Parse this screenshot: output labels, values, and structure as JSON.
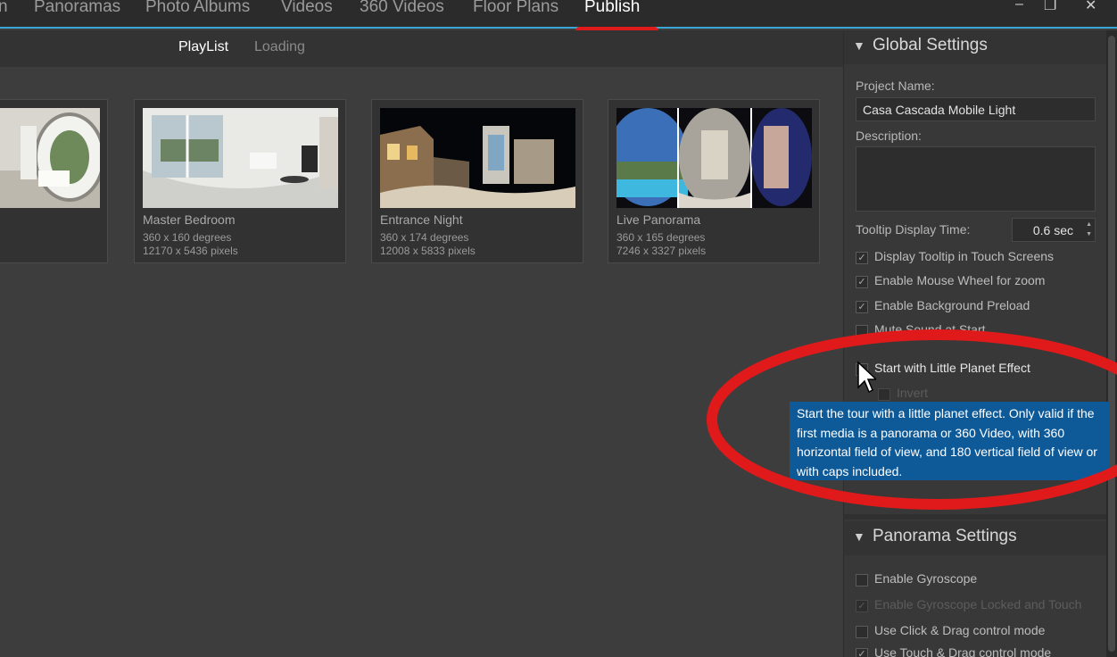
{
  "nav": {
    "items": [
      "n",
      "Panoramas",
      "Photo Albums",
      "Videos",
      "360 Videos",
      "Floor Plans",
      "Publish"
    ],
    "active": "Publish",
    "window": {
      "minimize": "–",
      "restore": "❐",
      "close": "✕"
    }
  },
  "subtabs": {
    "playlist": "PlayList",
    "loading": "Loading"
  },
  "cards": [
    {
      "title": "",
      "meta1": "",
      "meta2": ""
    },
    {
      "title": "Master Bedroom",
      "meta1": "360 x 160 degrees",
      "meta2": "12170 x 5436 pixels"
    },
    {
      "title": "Entrance Night",
      "meta1": "360 x 174 degrees",
      "meta2": "12008 x 5833 pixels"
    },
    {
      "title": "Live Panorama",
      "meta1": "360 x 165 degrees",
      "meta2": "7246 x 3327 pixels"
    }
  ],
  "global_settings": {
    "title": "Global Settings",
    "project_name_label": "Project Name:",
    "project_name_value": "Casa Cascada Mobile Light",
    "description_label": "Description:",
    "tooltip_time_label": "Tooltip Display Time:",
    "tooltip_time_value": "0.6 sec",
    "checkboxes": [
      {
        "label": "Display Tooltip in Touch Screens",
        "checked": true
      },
      {
        "label": "Enable Mouse Wheel for zoom",
        "checked": true
      },
      {
        "label": "Enable Background Preload",
        "checked": true
      },
      {
        "label": "Mute Sound at Start",
        "checked": false
      },
      {
        "label": "Start with Little Planet Effect",
        "checked": false
      },
      {
        "label": "Invert",
        "checked": false
      }
    ]
  },
  "tooltip": {
    "text": "Start the tour with a little planet effect. Only valid if the first media is a panorama or 360 Video, with 360 horizontal field of view, and 180 vertical field of view or with caps included."
  },
  "panorama_settings": {
    "title": "Panorama Settings",
    "checkboxes": [
      {
        "label": "Enable Gyroscope",
        "checked": false
      },
      {
        "label": "Enable Gyroscope Locked and Touch",
        "checked": true
      },
      {
        "label": "Use Click & Drag control mode",
        "checked": false
      },
      {
        "label": "Use Touch & Drag control mode",
        "checked": true
      }
    ]
  },
  "colors": {
    "accent": "#39a7d6",
    "highlight_red": "#e01a1a",
    "tooltip_bg": "#0e5a99"
  },
  "icons": [
    "collapse-arrow-icon",
    "checkmark-icon",
    "spinner-up-icon",
    "spinner-down-icon",
    "mouse-cursor-icon"
  ]
}
